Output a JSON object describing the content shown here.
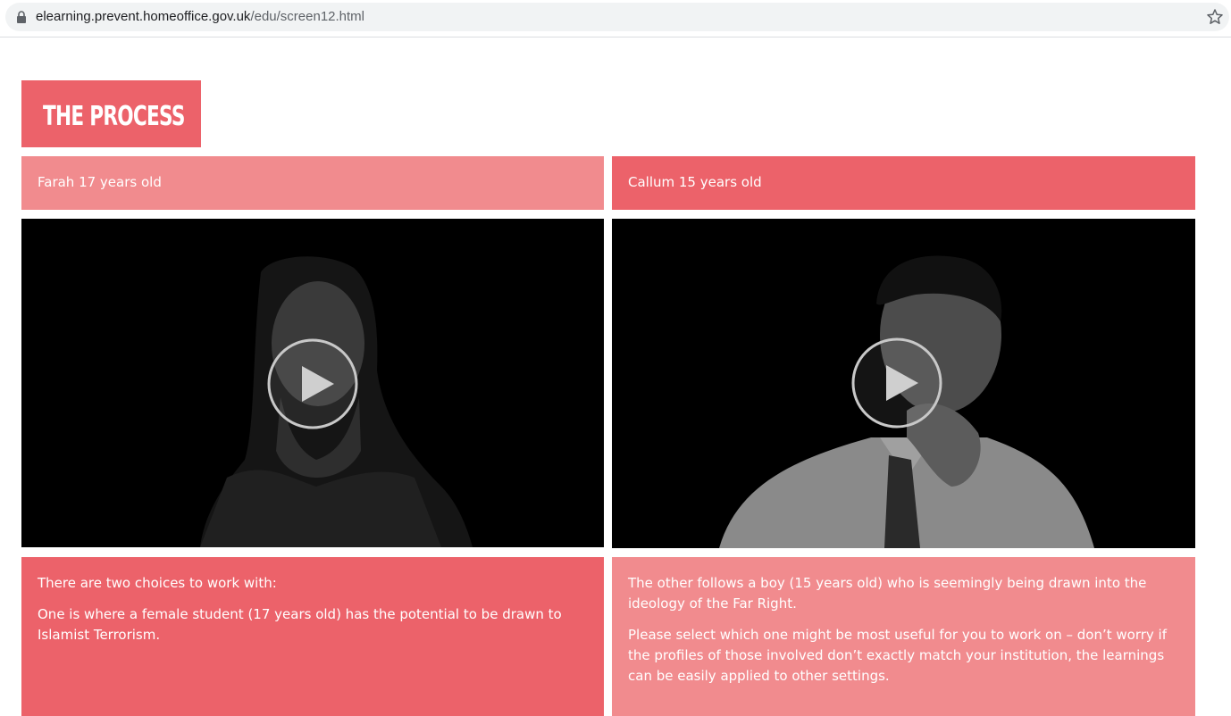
{
  "browser": {
    "url_host": "elearning.prevent.homeoffice.gov.uk",
    "url_path": "/edu/screen12.html",
    "lock_icon": "lock-icon",
    "star_icon": "star-icon"
  },
  "page": {
    "title": "THE PROCESS",
    "accent_color": "#ec626a",
    "accent_light_color": "#f18b8e"
  },
  "columns": [
    {
      "heading": "Farah 17 years old",
      "video_icon": "play-icon",
      "paragraphs": [
        "There are two choices to work with:",
        "One is where a female student (17 years old) has the potential to be drawn to Islamist Terrorism."
      ]
    },
    {
      "heading": "Callum 15 years old",
      "video_icon": "play-icon",
      "paragraphs": [
        "The other follows a boy (15 years old) who is seemingly being drawn into the ideology of the Far Right.",
        "Please select which one might be most useful for you to work on – don’t worry if the profiles of those involved don’t exactly match your institution, the learnings can be easily applied to other settings."
      ]
    }
  ]
}
